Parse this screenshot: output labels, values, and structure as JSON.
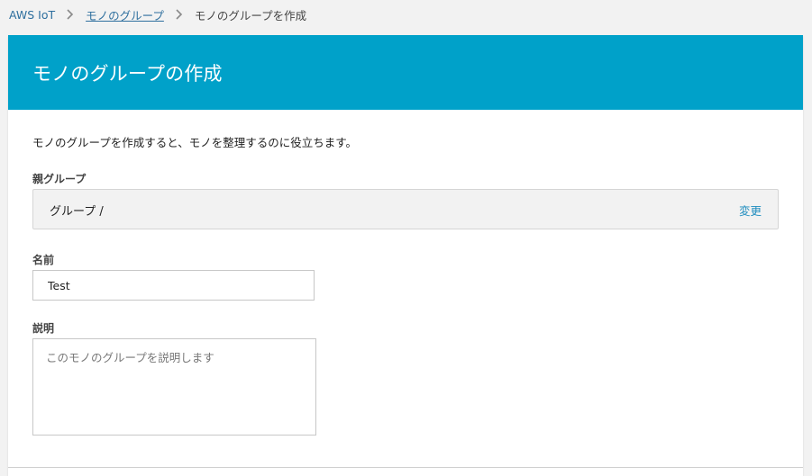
{
  "breadcrumb": {
    "root": "AWS IoT",
    "parent": "モノのグループ",
    "current": "モノのグループを作成"
  },
  "page": {
    "title": "モノのグループの作成",
    "description": "モノのグループを作成すると、モノを整理するのに役立ちます。"
  },
  "form": {
    "parent_group_label": "親グループ",
    "parent_group_value": "グループ /",
    "change_label": "変更",
    "name_label": "名前",
    "name_value": "Test",
    "description_label": "説明",
    "description_placeholder": "このモノのグループを説明します"
  },
  "colors": {
    "header_bg": "#00a1c9",
    "link": "#1f8dbf",
    "page_bg": "#f2f2f2"
  }
}
